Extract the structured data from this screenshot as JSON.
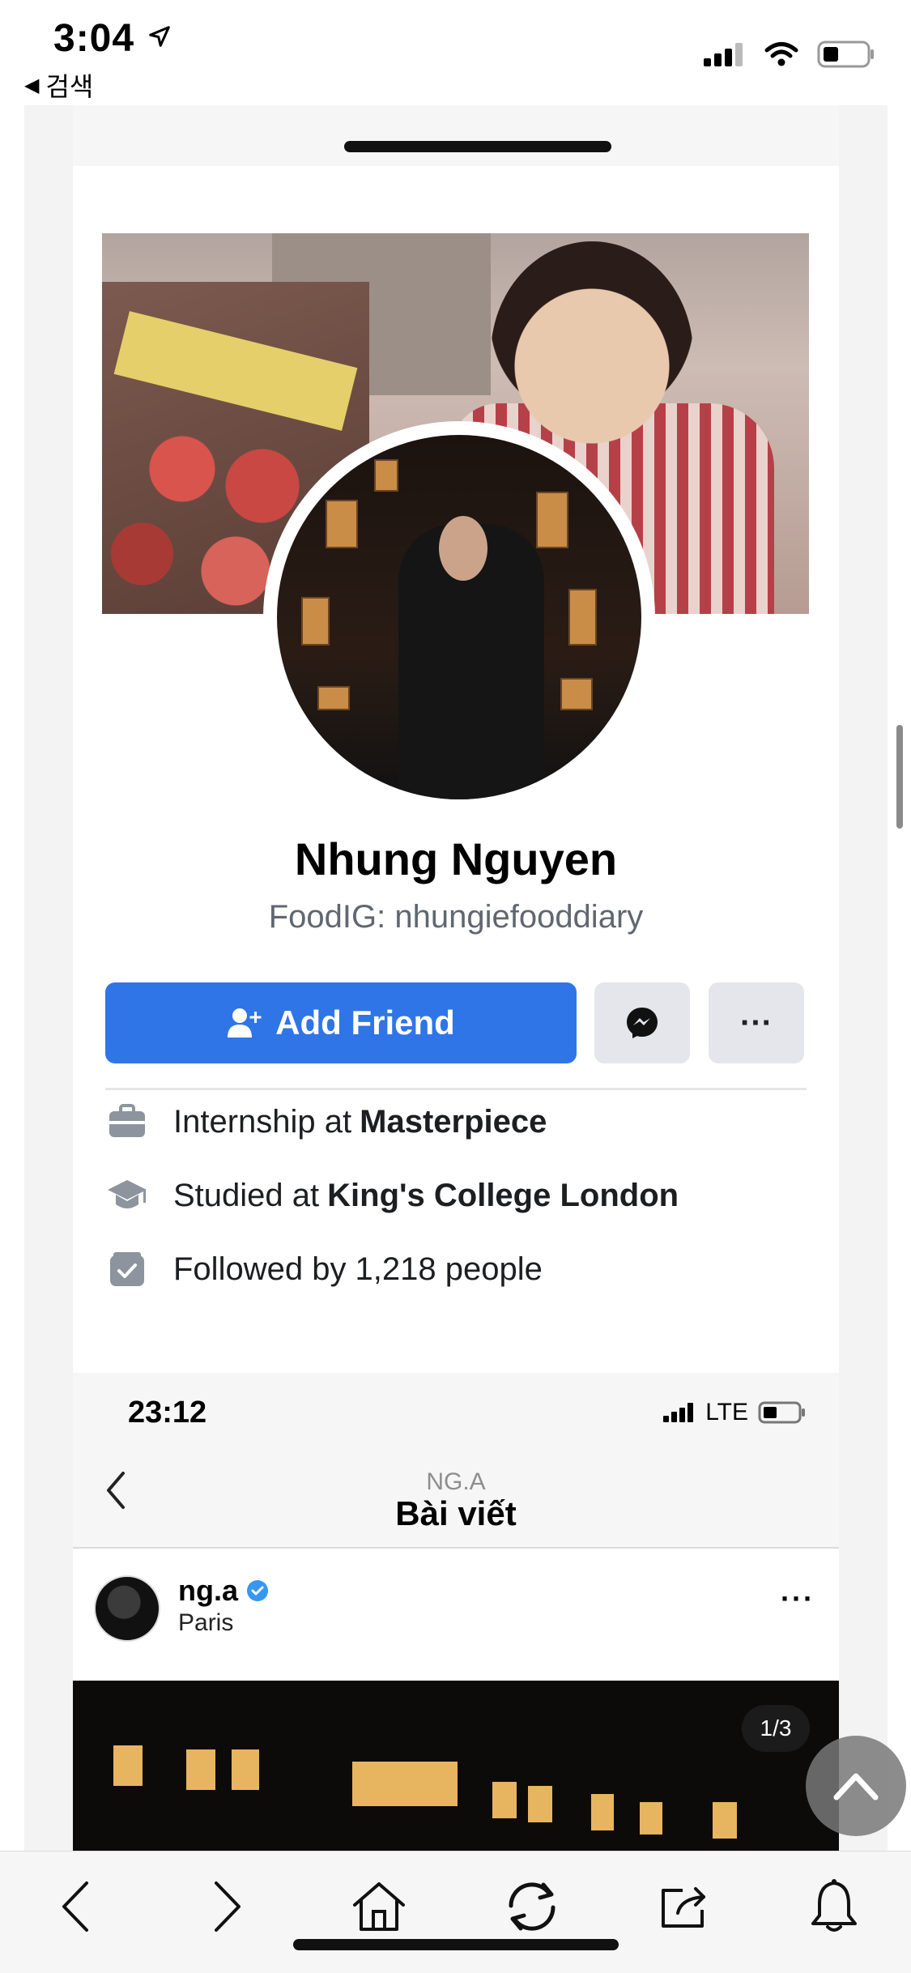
{
  "status_bar": {
    "time": "3:04",
    "back_label": "검색"
  },
  "profile": {
    "name": "Nhung Nguyen",
    "bio": "FoodIG: nhungiefooddiary",
    "add_friend_label": "Add Friend",
    "more_label": "···",
    "info": [
      {
        "icon": "briefcase-icon",
        "prefix": "Internship at",
        "bold": "Masterpiece"
      },
      {
        "icon": "graduation-cap-icon",
        "prefix": "Studied at",
        "bold": "King's College London"
      },
      {
        "icon": "followers-icon",
        "prefix": "Followed by 1,218 people",
        "bold": ""
      }
    ]
  },
  "instagram": {
    "time": "23:12",
    "network": "LTE",
    "account": "NG.A",
    "title": "Bài viết",
    "username": "ng.a",
    "location": "Paris",
    "more_label": "···",
    "counter": "1/3"
  },
  "colors": {
    "accent": "#2f75e8",
    "button_gray": "#e4e6eb",
    "verified": "#3897f0"
  }
}
